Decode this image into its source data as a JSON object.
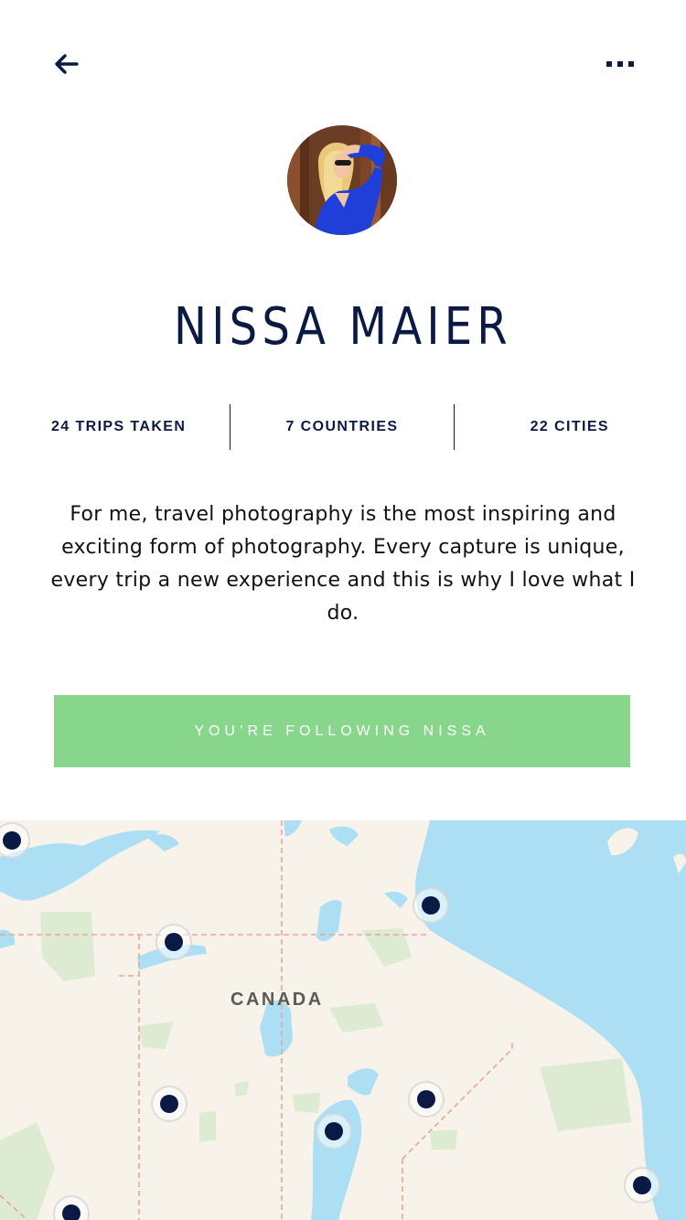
{
  "header": {
    "back_icon": "arrow-left-icon",
    "more_icon": "more-horizontal-icon"
  },
  "profile": {
    "name": "NISSA MAIER",
    "avatar_description": "avatar photo"
  },
  "stats": {
    "trips": "24 TRIPS TAKEN",
    "countries": "7 COUNTRIES",
    "cities": "22 CITIES"
  },
  "bio": "For me, travel photography is the most inspiring and exciting form of photography. Every capture is unique, every trip a new experience and this is why I love what I do.",
  "follow_button": {
    "label": "YOU’RE FOLLOWING NISSA",
    "color": "#88d68b"
  },
  "map": {
    "label": "CANADA",
    "pin_count": 9
  },
  "colors": {
    "navy": "#0b1a45",
    "green": "#88d68b",
    "water": "#acdff4",
    "land": "#f7f2ea",
    "park": "#dcebd2",
    "border": "#eaa69a"
  }
}
